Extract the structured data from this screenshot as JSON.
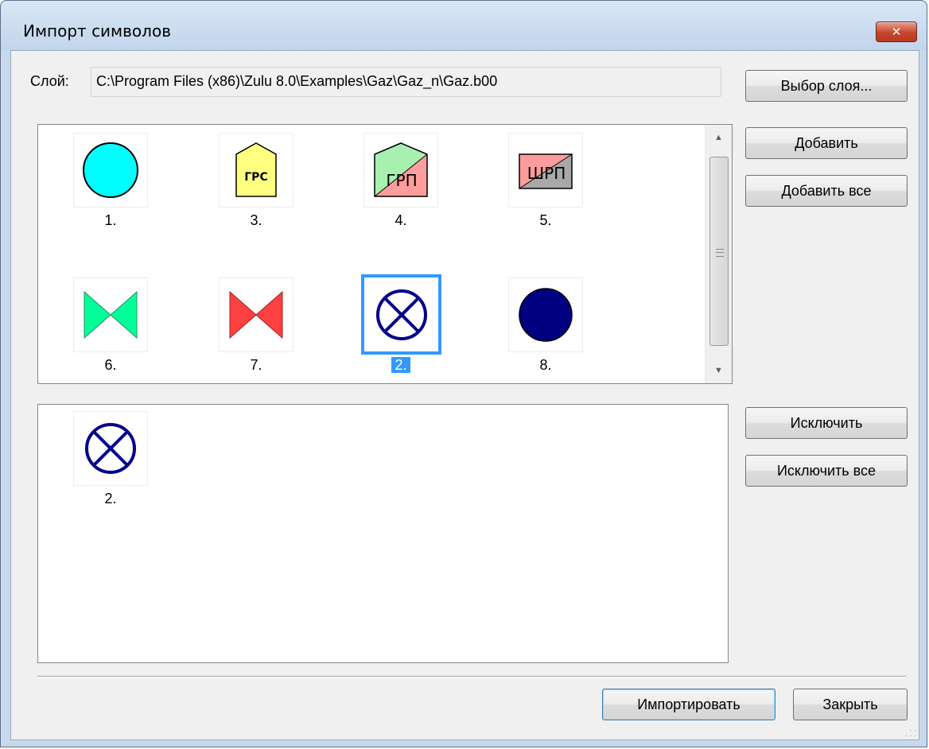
{
  "window": {
    "title": "Импорт символов",
    "close_glyph": "✕"
  },
  "layer": {
    "label": "Слой:",
    "path": "C:\\Program Files (x86)\\Zulu 8.0\\Examples\\Gaz\\Gaz_n\\Gaz.b00"
  },
  "buttons": {
    "select_layer": "Выбор слоя...",
    "add": "Добавить",
    "add_all": "Добавить все",
    "exclude": "Исключить",
    "exclude_all": "Исключить все",
    "import": "Импортировать",
    "close": "Закрыть"
  },
  "available_symbols": [
    {
      "caption": "1.",
      "icon": "cyan-circle-icon",
      "color": "#00ffff"
    },
    {
      "caption": "3.",
      "icon": "grs-pentagon-icon",
      "label": "ГРС",
      "color": "#ffff80"
    },
    {
      "caption": "4.",
      "icon": "grp-pentagon-icon",
      "label": "ГРП",
      "colors": [
        "#a8f0b0",
        "#ff9c9c"
      ]
    },
    {
      "caption": "5.",
      "icon": "shrp-box-icon",
      "label": "ШРП",
      "colors": [
        "#ff9c9c",
        "#a8a8a8"
      ]
    },
    {
      "caption": "6.",
      "icon": "green-valve-icon",
      "color": "#00ff99"
    },
    {
      "caption": "7.",
      "icon": "red-valve-icon",
      "color": "#ff4040"
    },
    {
      "caption": "2.",
      "icon": "crossed-circle-icon",
      "color": "#00008b",
      "selected": true
    },
    {
      "caption": "8.",
      "icon": "navy-circle-icon",
      "color": "#000080"
    }
  ],
  "selected_symbols": [
    {
      "caption": "2.",
      "icon": "crossed-circle-icon",
      "color": "#00008b"
    }
  ],
  "colors": {
    "selection": "#3399ff"
  }
}
